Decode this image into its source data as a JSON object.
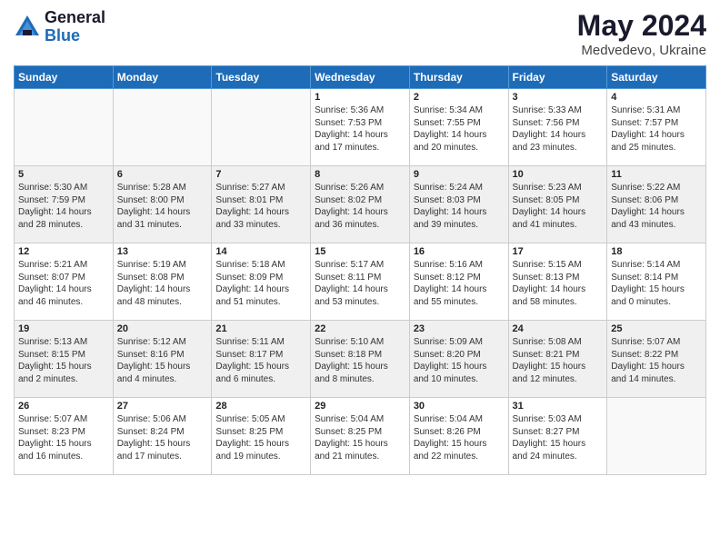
{
  "logo": {
    "general": "General",
    "blue": "Blue"
  },
  "title": "May 2024",
  "location": "Medvedevo, Ukraine",
  "days_header": [
    "Sunday",
    "Monday",
    "Tuesday",
    "Wednesday",
    "Thursday",
    "Friday",
    "Saturday"
  ],
  "weeks": [
    [
      {
        "day": "",
        "info": ""
      },
      {
        "day": "",
        "info": ""
      },
      {
        "day": "",
        "info": ""
      },
      {
        "day": "1",
        "info": "Sunrise: 5:36 AM\nSunset: 7:53 PM\nDaylight: 14 hours\nand 17 minutes."
      },
      {
        "day": "2",
        "info": "Sunrise: 5:34 AM\nSunset: 7:55 PM\nDaylight: 14 hours\nand 20 minutes."
      },
      {
        "day": "3",
        "info": "Sunrise: 5:33 AM\nSunset: 7:56 PM\nDaylight: 14 hours\nand 23 minutes."
      },
      {
        "day": "4",
        "info": "Sunrise: 5:31 AM\nSunset: 7:57 PM\nDaylight: 14 hours\nand 25 minutes."
      }
    ],
    [
      {
        "day": "5",
        "info": "Sunrise: 5:30 AM\nSunset: 7:59 PM\nDaylight: 14 hours\nand 28 minutes."
      },
      {
        "day": "6",
        "info": "Sunrise: 5:28 AM\nSunset: 8:00 PM\nDaylight: 14 hours\nand 31 minutes."
      },
      {
        "day": "7",
        "info": "Sunrise: 5:27 AM\nSunset: 8:01 PM\nDaylight: 14 hours\nand 33 minutes."
      },
      {
        "day": "8",
        "info": "Sunrise: 5:26 AM\nSunset: 8:02 PM\nDaylight: 14 hours\nand 36 minutes."
      },
      {
        "day": "9",
        "info": "Sunrise: 5:24 AM\nSunset: 8:03 PM\nDaylight: 14 hours\nand 39 minutes."
      },
      {
        "day": "10",
        "info": "Sunrise: 5:23 AM\nSunset: 8:05 PM\nDaylight: 14 hours\nand 41 minutes."
      },
      {
        "day": "11",
        "info": "Sunrise: 5:22 AM\nSunset: 8:06 PM\nDaylight: 14 hours\nand 43 minutes."
      }
    ],
    [
      {
        "day": "12",
        "info": "Sunrise: 5:21 AM\nSunset: 8:07 PM\nDaylight: 14 hours\nand 46 minutes."
      },
      {
        "day": "13",
        "info": "Sunrise: 5:19 AM\nSunset: 8:08 PM\nDaylight: 14 hours\nand 48 minutes."
      },
      {
        "day": "14",
        "info": "Sunrise: 5:18 AM\nSunset: 8:09 PM\nDaylight: 14 hours\nand 51 minutes."
      },
      {
        "day": "15",
        "info": "Sunrise: 5:17 AM\nSunset: 8:11 PM\nDaylight: 14 hours\nand 53 minutes."
      },
      {
        "day": "16",
        "info": "Sunrise: 5:16 AM\nSunset: 8:12 PM\nDaylight: 14 hours\nand 55 minutes."
      },
      {
        "day": "17",
        "info": "Sunrise: 5:15 AM\nSunset: 8:13 PM\nDaylight: 14 hours\nand 58 minutes."
      },
      {
        "day": "18",
        "info": "Sunrise: 5:14 AM\nSunset: 8:14 PM\nDaylight: 15 hours\nand 0 minutes."
      }
    ],
    [
      {
        "day": "19",
        "info": "Sunrise: 5:13 AM\nSunset: 8:15 PM\nDaylight: 15 hours\nand 2 minutes."
      },
      {
        "day": "20",
        "info": "Sunrise: 5:12 AM\nSunset: 8:16 PM\nDaylight: 15 hours\nand 4 minutes."
      },
      {
        "day": "21",
        "info": "Sunrise: 5:11 AM\nSunset: 8:17 PM\nDaylight: 15 hours\nand 6 minutes."
      },
      {
        "day": "22",
        "info": "Sunrise: 5:10 AM\nSunset: 8:18 PM\nDaylight: 15 hours\nand 8 minutes."
      },
      {
        "day": "23",
        "info": "Sunrise: 5:09 AM\nSunset: 8:20 PM\nDaylight: 15 hours\nand 10 minutes."
      },
      {
        "day": "24",
        "info": "Sunrise: 5:08 AM\nSunset: 8:21 PM\nDaylight: 15 hours\nand 12 minutes."
      },
      {
        "day": "25",
        "info": "Sunrise: 5:07 AM\nSunset: 8:22 PM\nDaylight: 15 hours\nand 14 minutes."
      }
    ],
    [
      {
        "day": "26",
        "info": "Sunrise: 5:07 AM\nSunset: 8:23 PM\nDaylight: 15 hours\nand 16 minutes."
      },
      {
        "day": "27",
        "info": "Sunrise: 5:06 AM\nSunset: 8:24 PM\nDaylight: 15 hours\nand 17 minutes."
      },
      {
        "day": "28",
        "info": "Sunrise: 5:05 AM\nSunset: 8:25 PM\nDaylight: 15 hours\nand 19 minutes."
      },
      {
        "day": "29",
        "info": "Sunrise: 5:04 AM\nSunset: 8:25 PM\nDaylight: 15 hours\nand 21 minutes."
      },
      {
        "day": "30",
        "info": "Sunrise: 5:04 AM\nSunset: 8:26 PM\nDaylight: 15 hours\nand 22 minutes."
      },
      {
        "day": "31",
        "info": "Sunrise: 5:03 AM\nSunset: 8:27 PM\nDaylight: 15 hours\nand 24 minutes."
      },
      {
        "day": "",
        "info": ""
      }
    ]
  ]
}
